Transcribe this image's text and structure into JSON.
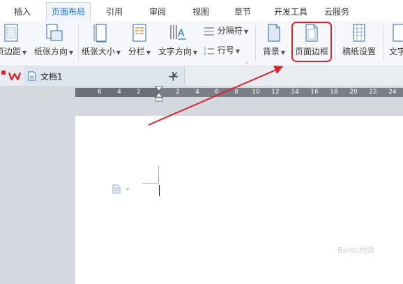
{
  "menu": {
    "tabs": [
      "插入",
      "页面布局",
      "引用",
      "审阅",
      "视图",
      "章节",
      "开发工具",
      "云服务"
    ],
    "active": "页面布局"
  },
  "ribbon": {
    "margins": "页边距",
    "orientation": "纸张方向",
    "size": "纸张大小",
    "columns": "分栏",
    "text_direction": "文字方向",
    "separator": "分隔符",
    "line_numbers": "行号",
    "background": "背景",
    "page_border": "页面边框",
    "paper_setup": "稿纸设置",
    "text_cut": "文字"
  },
  "doc_tab": {
    "title": "文档1",
    "close": "×",
    "new": "+"
  },
  "ruler": {
    "labels": [
      "6",
      "4",
      "2",
      "2",
      "4",
      "6",
      "8",
      "10",
      "12",
      "14",
      "16",
      "18",
      "20",
      "22",
      "24"
    ]
  },
  "watermark": "Baidu经验",
  "colors": {
    "accent": "#1e6fd9",
    "highlight": "#d9242b",
    "arrow": "#d9242b",
    "wps_logo": "#d9242b"
  }
}
